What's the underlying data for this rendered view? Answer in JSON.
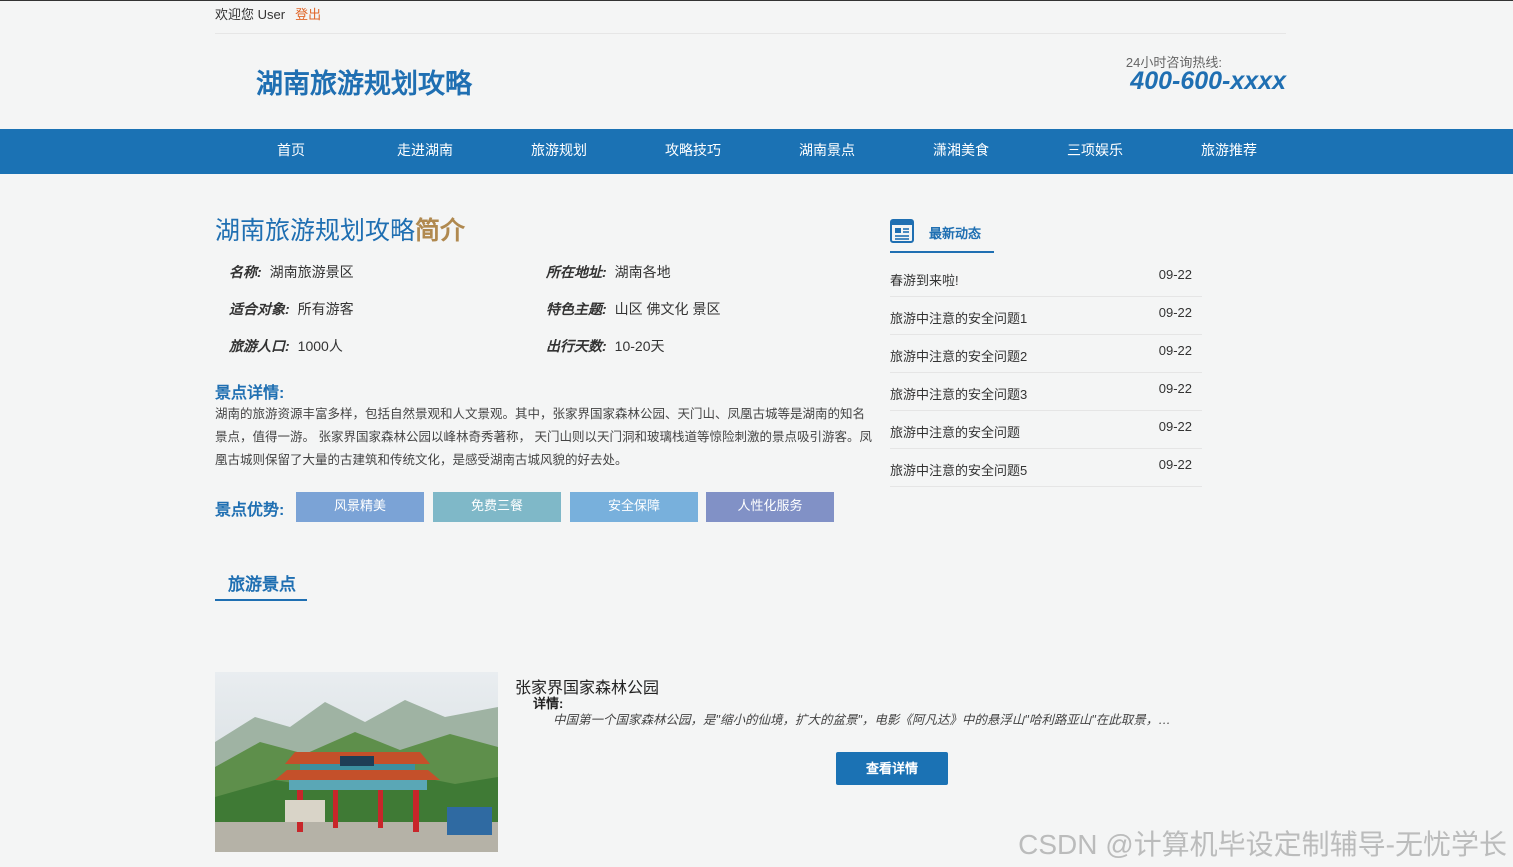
{
  "topbar": {
    "welcome": "欢迎您 User",
    "logout": "登出"
  },
  "header": {
    "site_title": "湖南旅游规划攻略",
    "hotline_label": "24小时咨询热线:",
    "hotline_number": "400-600-xxxx"
  },
  "nav": {
    "items": [
      "首页",
      "走进湖南",
      "旅游规划",
      "攻略技巧",
      "湖南景点",
      "潇湘美食",
      "三项娱乐",
      "旅游推荐"
    ]
  },
  "intro": {
    "title_main": "湖南旅游规划攻略",
    "title_accent": "简介",
    "fields": [
      {
        "key": "名称:",
        "value": "湖南旅游景区"
      },
      {
        "key": "所在地址:",
        "value": "湖南各地"
      },
      {
        "key": "适合对象:",
        "value": "所有游客"
      },
      {
        "key": "特色主题:",
        "value": "山区 佛文化 景区"
      },
      {
        "key": "旅游人口:",
        "value": "1000人"
      },
      {
        "key": "出行天数:",
        "value": "10-20天"
      }
    ],
    "detail_head": "景点详情:",
    "detail_text": "湖南的旅游资源丰富多样，包括自然景观和人文景观。其中，张家界国家森林公园、天门山、凤凰古城等是湖南的知名景点，值得一游。 张家界国家森林公园以峰林奇秀著称， 天门山则以天门洞和玻璃栈道等惊险刺激的景点吸引游客。凤凰古城则保留了大量的古建筑和传统文化，是感受湖南古城风貌的好去处。",
    "advantage_label": "景点优势:",
    "advantages": [
      {
        "label": "风景精美",
        "color": "#7ba3d6"
      },
      {
        "label": "免费三餐",
        "color": "#7fb8c8"
      },
      {
        "label": "安全保障",
        "color": "#78b0dc"
      },
      {
        "label": "人性化服务",
        "color": "#8191c6"
      }
    ]
  },
  "news": {
    "title": "最新动态",
    "items": [
      {
        "title": "春游到来啦!",
        "date": "09-22"
      },
      {
        "title": "旅游中注意的安全问题1",
        "date": "09-22"
      },
      {
        "title": "旅游中注意的安全问题2",
        "date": "09-22"
      },
      {
        "title": "旅游中注意的安全问题3",
        "date": "09-22"
      },
      {
        "title": "旅游中注意的安全问题",
        "date": "09-22"
      },
      {
        "title": "旅游中注意的安全问题5",
        "date": "09-22"
      }
    ]
  },
  "scenic": {
    "section_title": "旅游景点",
    "items": [
      {
        "name": "张家界国家森林公园",
        "detail_label": "详情:",
        "description": "中国第一个国家森林公园，是\"缩小的仙境，扩大的盆景\"，电影《阿凡达》中的悬浮山\"哈利路亚山\"在此取景，…",
        "button": "查看详情"
      }
    ]
  },
  "watermark": "CSDN @计算机毕设定制辅导-无忧学长"
}
